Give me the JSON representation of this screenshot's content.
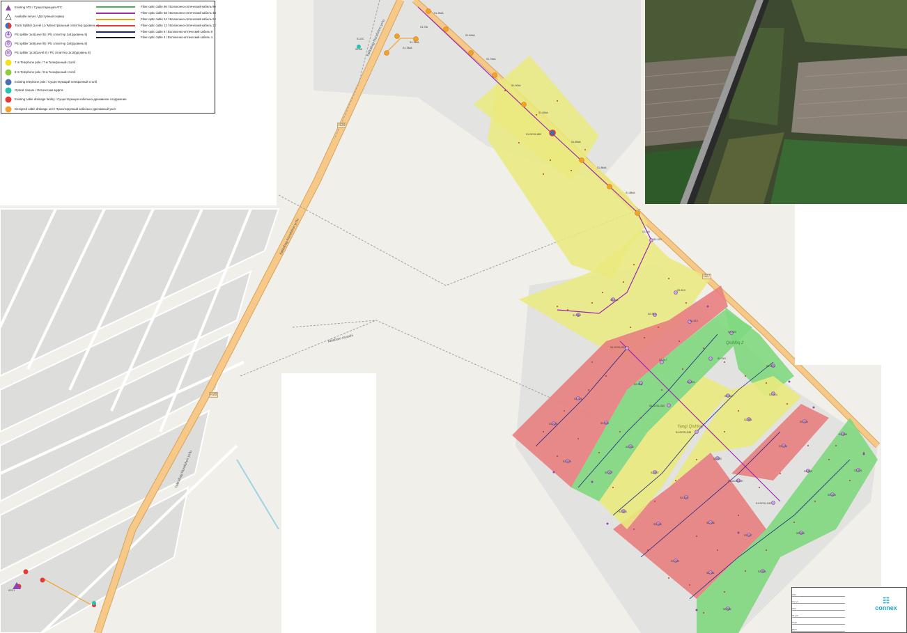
{
  "legend": {
    "symbols": [
      {
        "label": "Existing ATS / Существующая АТС",
        "icon": "triangle-icon",
        "color": "#8e44ad"
      },
      {
        "label": "Available server / Доступный сервер",
        "icon": "server-triangle-icon",
        "color": "#ffffff"
      },
      {
        "label": "Truck Splitter (Level 1) / Магистральный сплиттер (уровень 1)",
        "icon": "split-circle-icon",
        "color": "#3b6fb6"
      },
      {
        "label": "Plc splitter 1x4(Level 5) / Plc сплиттер 1x4(уровень 5)",
        "icon": "circle-4-icon",
        "color": "#c9a6e0",
        "glyph": "4"
      },
      {
        "label": "Plc splitter 1x8(Level 8) / Plc сплиттер 1x8(уровень 8)",
        "icon": "circle-8-icon",
        "color": "#c9a6e0",
        "glyph": "8"
      },
      {
        "label": "Plc splitter 1x16(Level 8) / Plc сплиттер 1x16(уровень 8)",
        "icon": "circle-16-icon",
        "color": "#c9a6e0",
        "glyph": "16"
      },
      {
        "label": "7 m Telephone pole / 7 м Телефонный столб",
        "icon": "yellow-dot-icon",
        "color": "#f2e21b"
      },
      {
        "label": "8 m Telephone pole / 8 м Телефонный столб",
        "icon": "green-dot-icon",
        "color": "#8fcc3c"
      },
      {
        "label": "Existing telephone pole / Существующий телефонный столб",
        "icon": "blue-dot-icon",
        "color": "#4a6fb3"
      },
      {
        "label": "Optical closure / Оптическая муфта",
        "icon": "teal-dot-icon",
        "color": "#26c2b0"
      },
      {
        "label": "Existing cable drainage facility / Существующее кабельно-дренажное сооружение",
        "icon": "red-dot-icon",
        "color": "#e53935"
      },
      {
        "label": "Designed cable drainage unit / Проектируемый кабельно-дренажный узел",
        "icon": "orange-dot-icon",
        "color": "#f4a12a"
      }
    ],
    "cables": [
      {
        "label": "Fiber-optic cable 96 / Волоконно-оптический кабель 96",
        "color": "#4caf50"
      },
      {
        "label": "Fiber-optic cable 48 / Волоконно-оптический кабель 48",
        "color": "#9c27b0"
      },
      {
        "label": "Fiber-optic cable 24 / Волоконно-оптический кабель 24",
        "color": "#f39c12"
      },
      {
        "label": "Fiber-optic cable 12 / Волоконно-оптический кабель 12",
        "color": "#e53935"
      },
      {
        "label": "Fiber-optic cable 8 / Волоконно-оптический кабель 8",
        "color": "#1a237e"
      },
      {
        "label": "Fiber-optic cable 4 / Волоконно-оптический кабель 4",
        "color": "#111111"
      }
    ]
  },
  "map": {
    "roads": [
      {
        "label": "R28"
      },
      {
        "label": "R28"
      },
      {
        "label": "R27"
      }
    ],
    "street_names": [
      "Yakkabag-Nurafshon yo'lu",
      "Yakkabag-Nurafshon yo'lu",
      "Yakkabag-Nurafshon yo'lu",
      "Ablaham ravochi"
    ],
    "zone_labels": [
      "Qishloq 2",
      "Yangi Qishloq"
    ],
    "colors": {
      "background": "#f1efe9",
      "road": "#f6c988",
      "road_edge": "#d9a25a",
      "yellow_zone": "#eaea7e",
      "red_zone": "#e88080",
      "green_zone": "#80d880",
      "block": "#dcdcdc"
    }
  },
  "title_block": {
    "company": "connex",
    "rows": [
      "Изм.",
      "Кол.уч.",
      "Лист",
      "№ док.",
      "Подп.",
      "Дата"
    ]
  }
}
